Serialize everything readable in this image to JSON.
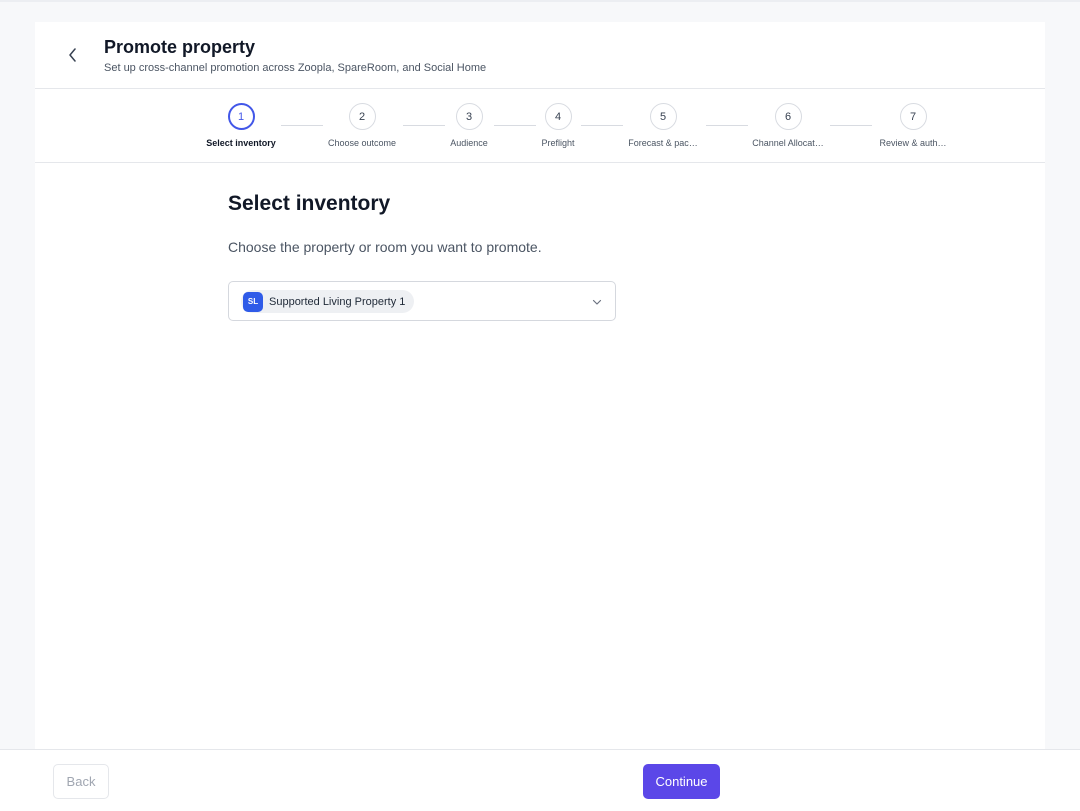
{
  "header": {
    "title": "Promote property",
    "subtitle": "Set up cross-channel promotion across Zoopla, SpareRoom, and Social Home"
  },
  "stepper": {
    "steps": [
      {
        "number": "1",
        "label": "Select inventory",
        "active": true
      },
      {
        "number": "2",
        "label": "Choose outcome",
        "active": false
      },
      {
        "number": "3",
        "label": "Audience",
        "active": false
      },
      {
        "number": "4",
        "label": "Preflight",
        "active": false
      },
      {
        "number": "5",
        "label": "Forecast & pac…",
        "active": false
      },
      {
        "number": "6",
        "label": "Channel Allocat…",
        "active": false
      },
      {
        "number": "7",
        "label": "Review & auth…",
        "active": false
      }
    ]
  },
  "main": {
    "section_title": "Select inventory",
    "section_description": "Choose the property or room you want to promote.",
    "inventory_select": {
      "selected_avatar": "SL",
      "selected_label": "Supported Living Property 1"
    }
  },
  "footer": {
    "back_label": "Back",
    "continue_label": "Continue"
  },
  "colors": {
    "accent": "#5b47e8",
    "active_step": "#4257e8",
    "avatar": "#2f5be8"
  }
}
